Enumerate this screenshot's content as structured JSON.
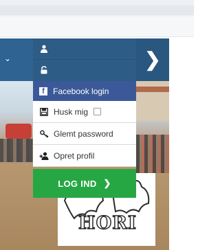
{
  "colors": {
    "nav_blue": "#2c5b85",
    "facebook_blue": "#3b5998",
    "login_green": "#26a744",
    "menu_bg": "#ffffff",
    "text_dark": "#333333"
  },
  "nav": {
    "left_toggle_icon": "chevron-down-icon",
    "right_next_icon": "chevron-right-icon",
    "right_next_glyph": "❯"
  },
  "login": {
    "username_icon": "user-icon",
    "password_icon": "lock-icon",
    "facebook_label": "Facebook login",
    "remember_label": "Husk mig",
    "remember_checked": false,
    "forgot_label": "Glemt password",
    "create_label": "Opret profil",
    "submit_label": "LOG IND",
    "submit_arrow": "❯"
  },
  "logo": {
    "text": "HORI"
  }
}
